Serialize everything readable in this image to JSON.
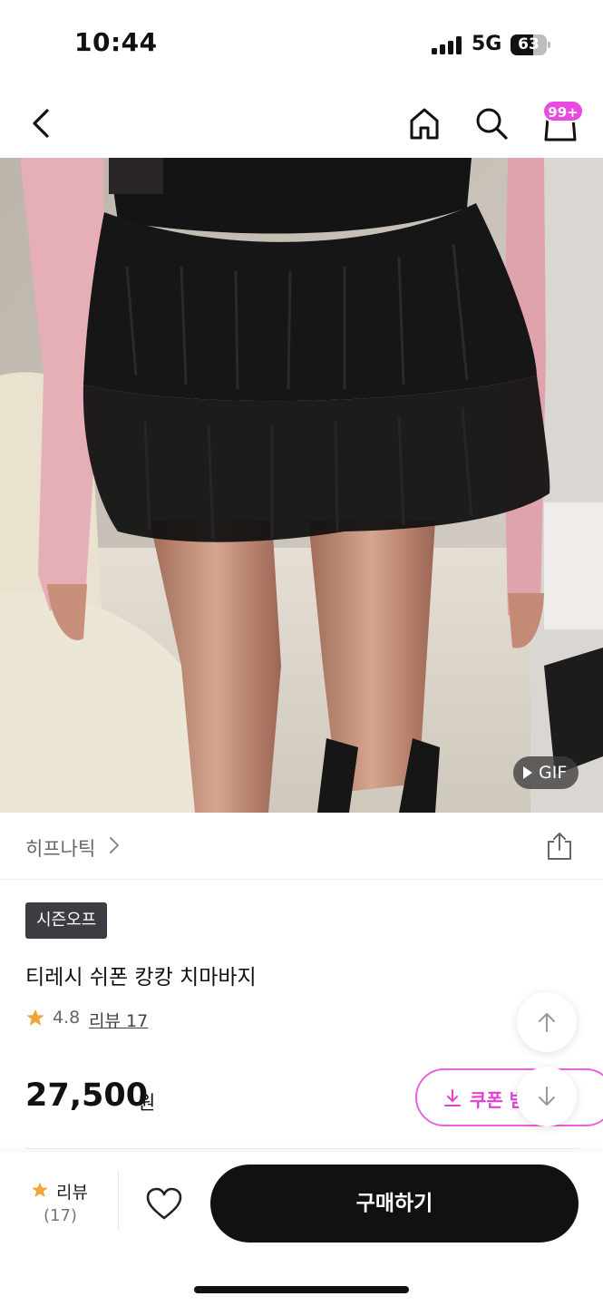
{
  "status_bar": {
    "time": "10:44",
    "network": "5G",
    "battery_level": "63",
    "battery_fraction": 0.63
  },
  "nav": {
    "back_icon": "chevron-left-icon",
    "home_icon": "home-icon",
    "search_icon": "search-icon",
    "cart_icon": "shopping-bag-icon",
    "cart_badge": "99+",
    "accent_color": "#e94be0"
  },
  "hero": {
    "gif_label": "GIF"
  },
  "brand": {
    "name": "히프나틱",
    "chevron_icon": "chevron-right-icon",
    "share_icon": "share-icon"
  },
  "product": {
    "season_badge": "시즌오프",
    "title": "티레시 쉬폰 캉캉 치마바지",
    "rating": "4.8",
    "review_link": "리뷰 17",
    "price": "27,500",
    "price_unit": "원",
    "coupon_label": "쿠폰 받기"
  },
  "fab": {
    "up_icon": "arrow-up-icon",
    "down_icon": "arrow-down-icon"
  },
  "bottom_bar": {
    "review_label": "리뷰",
    "review_count": "(17)",
    "heart_icon": "heart-icon",
    "buy_label": "구매하기"
  }
}
